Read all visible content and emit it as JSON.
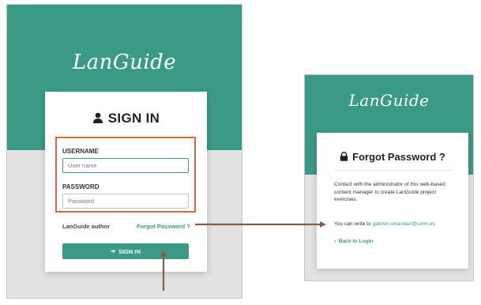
{
  "colors": {
    "brand": "#3b9a85",
    "annotation_box": "#d2693f",
    "annotation_arrow": "#8a5a4a"
  },
  "login": {
    "logo": "LanGuide",
    "title": "SIGN IN",
    "title_icon": "user-icon",
    "username_label": "USERNAME",
    "username_placeholder": "User name",
    "password_label": "PASSWORD",
    "password_placeholder": "Password",
    "author_text": "LanGuide author",
    "forgot_link": "Forgot Password ?",
    "signin_button": "SIGN IN",
    "signin_icon": "login-icon"
  },
  "forgot": {
    "logo": "LanGuide",
    "title": "Forgot Password ?",
    "title_icon": "lock-icon",
    "message": "Contact with the administrator of this web-based content manager to create LanGuide project exercises.",
    "write_prefix": "You can write to",
    "email": "gabriel.sebastian@uclm.es",
    "back_link": "Back to Login",
    "back_icon": "chevron-left-icon"
  }
}
